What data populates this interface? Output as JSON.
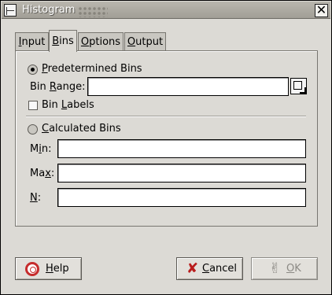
{
  "window": {
    "title": "Histogram",
    "close_label": "✕"
  },
  "tabs": [
    {
      "label": "Input",
      "mnemonic": "I",
      "rest": "nput"
    },
    {
      "label": "Bins",
      "mnemonic": "B",
      "rest": "ins"
    },
    {
      "label": "Options",
      "mnemonic": "O",
      "rest": "ptions"
    },
    {
      "label": "Output",
      "mnemonic": "O",
      "rest": "utput"
    }
  ],
  "active_tab": "Bins",
  "bins": {
    "predetermined": {
      "pre": "",
      "mn": "P",
      "post": "redetermined Bins",
      "selected": true
    },
    "bin_range": {
      "pre": "Bin ",
      "mn": "R",
      "post": "ange:",
      "value": ""
    },
    "bin_labels": {
      "pre": "Bin ",
      "mn": "L",
      "post": "abels",
      "checked": false
    },
    "calculated": {
      "pre": "",
      "mn": "C",
      "post": "alculated Bins",
      "selected": false
    },
    "min": {
      "pre": "M",
      "mn": "i",
      "post": "n:",
      "value": ""
    },
    "max": {
      "pre": "Ma",
      "mn": "x",
      "post": ":",
      "value": ""
    },
    "n": {
      "pre": "",
      "mn": "N",
      "post": ":",
      "value": ""
    }
  },
  "buttons": {
    "help": {
      "mn": "H",
      "rest": "elp"
    },
    "cancel": {
      "mn": "C",
      "rest": "ancel"
    },
    "ok": {
      "mn": "O",
      "rest": "K",
      "enabled": false
    }
  }
}
